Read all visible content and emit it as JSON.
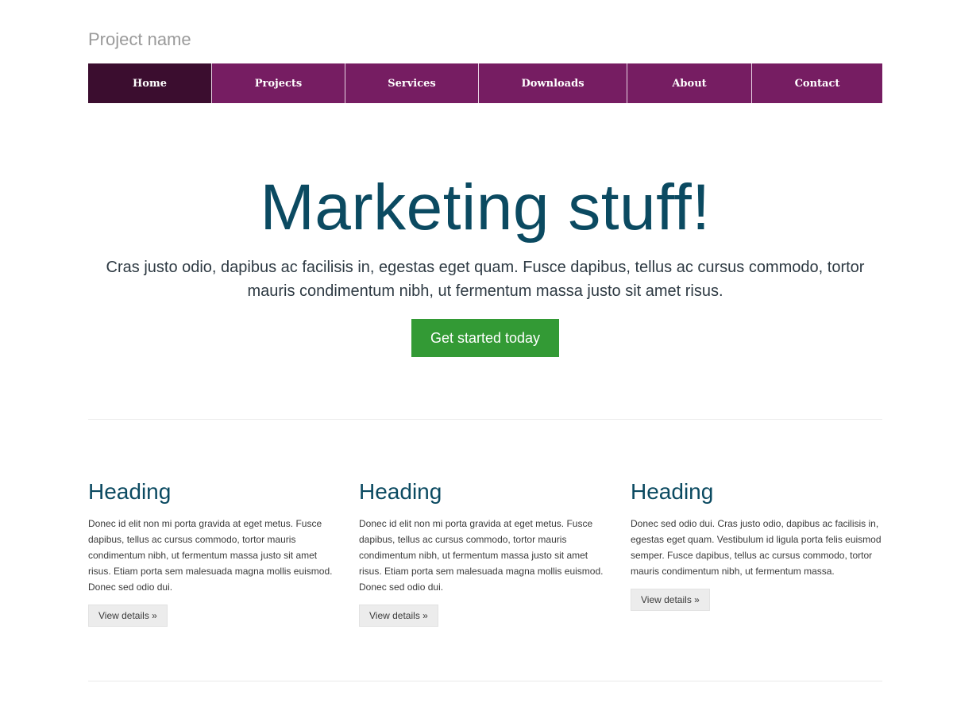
{
  "brand": "Project name",
  "nav": [
    {
      "label": "Home",
      "active": true
    },
    {
      "label": "Projects",
      "active": false
    },
    {
      "label": "Services",
      "active": false
    },
    {
      "label": "Downloads",
      "active": false
    },
    {
      "label": "About",
      "active": false
    },
    {
      "label": "Contact",
      "active": false
    }
  ],
  "hero": {
    "title": "Marketing stuff!",
    "text": "Cras justo odio, dapibus ac facilisis in, egestas eget quam. Fusce dapibus, tellus ac cursus commodo, tortor mauris condimentum nibh, ut fermentum massa justo sit amet risus.",
    "cta_label": "Get started today"
  },
  "columns": [
    {
      "heading": "Heading",
      "text": "Donec id elit non mi porta gravida at eget metus. Fusce dapibus, tellus ac cursus commodo, tortor mauris condimentum nibh, ut fermentum massa justo sit amet risus. Etiam porta sem malesuada magna mollis euismod. Donec sed odio dui.",
      "button_label": "View details »"
    },
    {
      "heading": "Heading",
      "text": "Donec id elit non mi porta gravida at eget metus. Fusce dapibus, tellus ac cursus commodo, tortor mauris condimentum nibh, ut fermentum massa justo sit amet risus. Etiam porta sem malesuada magna mollis euismod. Donec sed odio dui.",
      "button_label": "View details »"
    },
    {
      "heading": "Heading",
      "text": "Donec sed odio dui. Cras justo odio, dapibus ac facilisis in, egestas eget quam. Vestibulum id ligula porta felis euismod semper. Fusce dapibus, tellus ac cursus commodo, tortor mauris condimentum nibh, ut fermentum massa.",
      "button_label": "View details »"
    }
  ],
  "colors": {
    "nav_bg": "#761d62",
    "nav_active_bg": "#3b0d2f",
    "heading": "#0b4a61",
    "cta_bg": "#339a35"
  }
}
